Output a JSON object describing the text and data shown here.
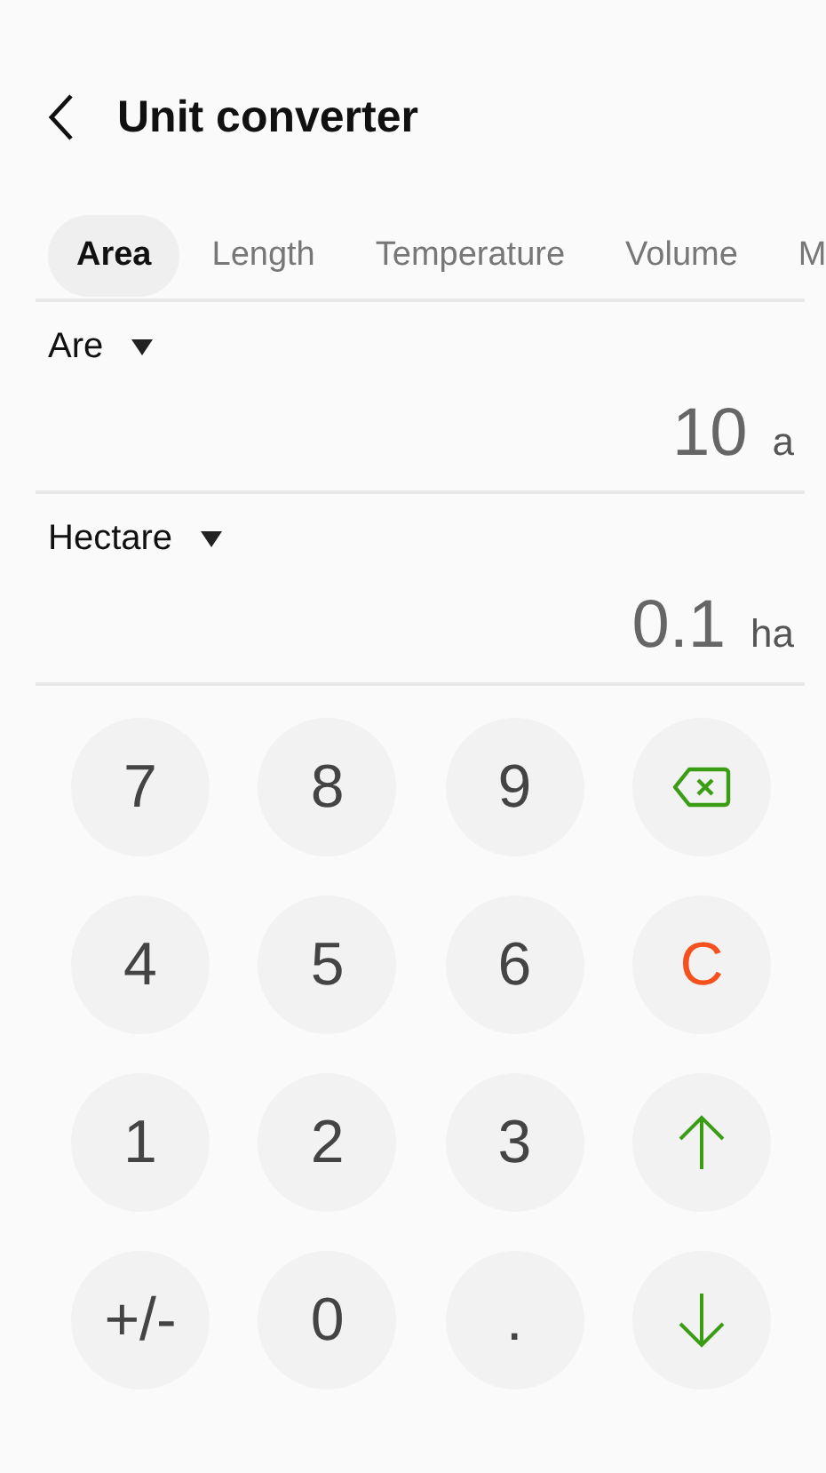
{
  "header": {
    "title": "Unit converter"
  },
  "tabs": [
    {
      "label": "Area",
      "selected": true
    },
    {
      "label": "Length",
      "selected": false
    },
    {
      "label": "Temperature",
      "selected": false
    },
    {
      "label": "Volume",
      "selected": false
    },
    {
      "label": "M",
      "selected": false
    }
  ],
  "conversions": [
    {
      "unit": "Are",
      "value": "10",
      "symbol": "a"
    },
    {
      "unit": "Hectare",
      "value": "0.1",
      "symbol": "ha"
    }
  ],
  "keypad": [
    {
      "kind": "digit",
      "label": "7"
    },
    {
      "kind": "digit",
      "label": "8"
    },
    {
      "kind": "digit",
      "label": "9"
    },
    {
      "kind": "backspace"
    },
    {
      "kind": "digit",
      "label": "4"
    },
    {
      "kind": "digit",
      "label": "5"
    },
    {
      "kind": "digit",
      "label": "6"
    },
    {
      "kind": "clear",
      "label": "C"
    },
    {
      "kind": "digit",
      "label": "1"
    },
    {
      "kind": "digit",
      "label": "2"
    },
    {
      "kind": "digit",
      "label": "3"
    },
    {
      "kind": "up"
    },
    {
      "kind": "digit",
      "label": "+/-"
    },
    {
      "kind": "digit",
      "label": "0"
    },
    {
      "kind": "digit",
      "label": "."
    },
    {
      "kind": "down"
    }
  ]
}
